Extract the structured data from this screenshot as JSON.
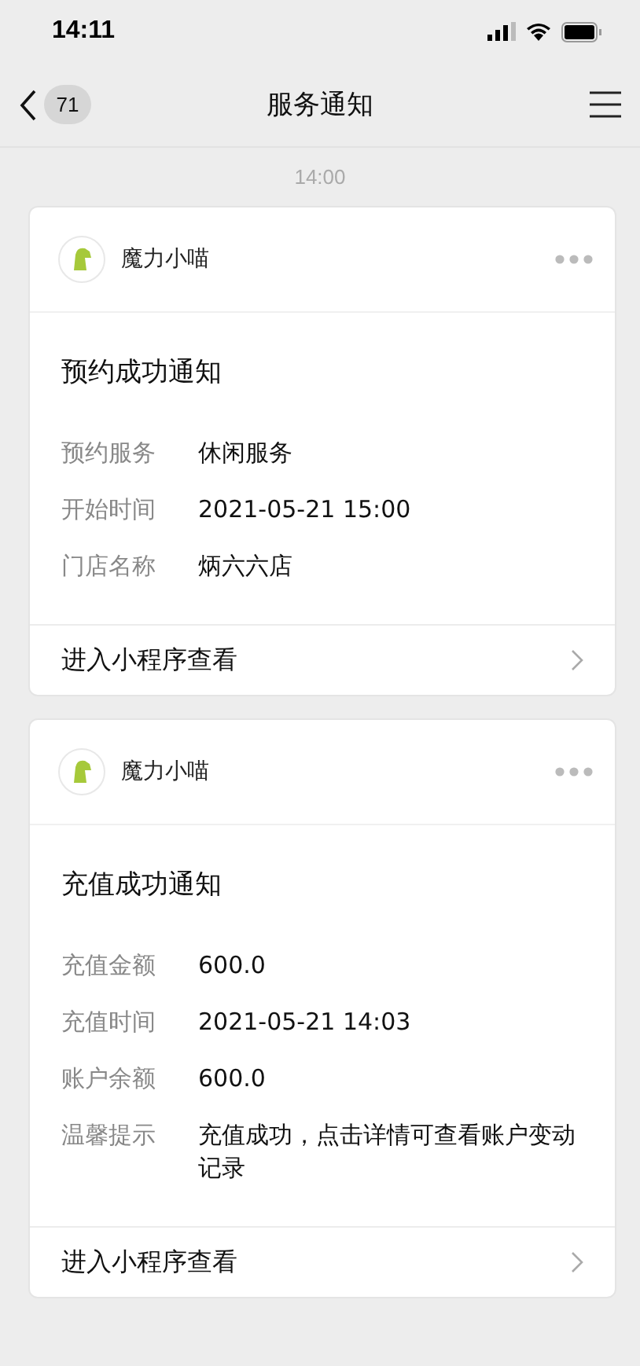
{
  "status_bar": {
    "time": "14:11"
  },
  "nav": {
    "back_count": "71",
    "title": "服务通知"
  },
  "timestamp": "14:00",
  "cards": [
    {
      "sender": "魔力小喵",
      "title": "预约成功通知",
      "fields": [
        {
          "label": "预约服务",
          "value": "休闲服务"
        },
        {
          "label": "开始时间",
          "value": "2021-05-21 15:00"
        },
        {
          "label": "门店名称",
          "value": "炳六六店"
        }
      ],
      "link": "进入小程序查看"
    },
    {
      "sender": "魔力小喵",
      "title": "充值成功通知",
      "fields": [
        {
          "label": "充值金额",
          "value": "600.0"
        },
        {
          "label": "充值时间",
          "value": "2021-05-21 14:03"
        },
        {
          "label": "账户余额",
          "value": "600.0"
        },
        {
          "label": "温馨提示",
          "value": "充值成功，点击详情可查看账户变动记录"
        }
      ],
      "link": "进入小程序查看"
    }
  ]
}
